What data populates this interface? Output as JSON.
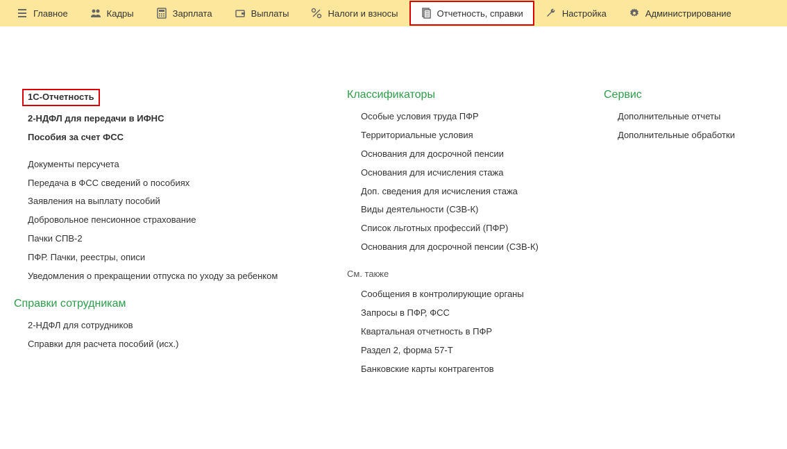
{
  "nav": {
    "items": [
      {
        "label": "Главное",
        "icon": "menu-icon"
      },
      {
        "label": "Кадры",
        "icon": "people-icon"
      },
      {
        "label": "Зарплата",
        "icon": "calc-icon"
      },
      {
        "label": "Выплаты",
        "icon": "wallet-icon"
      },
      {
        "label": "Налоги и взносы",
        "icon": "percent-icon"
      },
      {
        "label": "Отчетность, справки",
        "icon": "doc-icon",
        "highlighted": true
      },
      {
        "label": "Настройка",
        "icon": "wrench-icon"
      },
      {
        "label": "Администрирование",
        "icon": "gear-icon"
      }
    ]
  },
  "col1": {
    "bold_items": [
      "1С-Отчетность",
      "2-НДФЛ для передачи в ИФНС",
      "Пособия за счет ФСС"
    ],
    "items": [
      "Документы персучета",
      "Передача в ФСС сведений о пособиях",
      "Заявления на выплату пособий",
      "Добровольное пенсионное страхование",
      "Пачки СПВ-2",
      "ПФР. Пачки, реестры, описи",
      "Уведомления о прекращении отпуска по уходу за ребенком"
    ],
    "section2_head": "Справки сотрудникам",
    "section2_items": [
      "2-НДФЛ для сотрудников",
      "Справки для расчета пособий (исх.)"
    ]
  },
  "col2": {
    "head": "Классификаторы",
    "items": [
      "Особые условия труда ПФР",
      "Территориальные условия",
      "Основания для досрочной пенсии",
      "Основания для исчисления стажа",
      "Доп. сведения для исчисления стажа",
      "Виды деятельности (СЗВ-К)",
      "Список льготных профессий (ПФР)",
      "Основания для досрочной пенсии (СЗВ-К)"
    ],
    "see_also_label": "См. также",
    "see_also": [
      "Сообщения в контролирующие органы",
      "Запросы в ПФР, ФСС",
      "Квартальная отчетность в ПФР",
      "Раздел 2, форма 57-Т",
      "Банковские карты контрагентов"
    ]
  },
  "col3": {
    "head": "Сервис",
    "items": [
      "Дополнительные отчеты",
      "Дополнительные обработки"
    ]
  }
}
